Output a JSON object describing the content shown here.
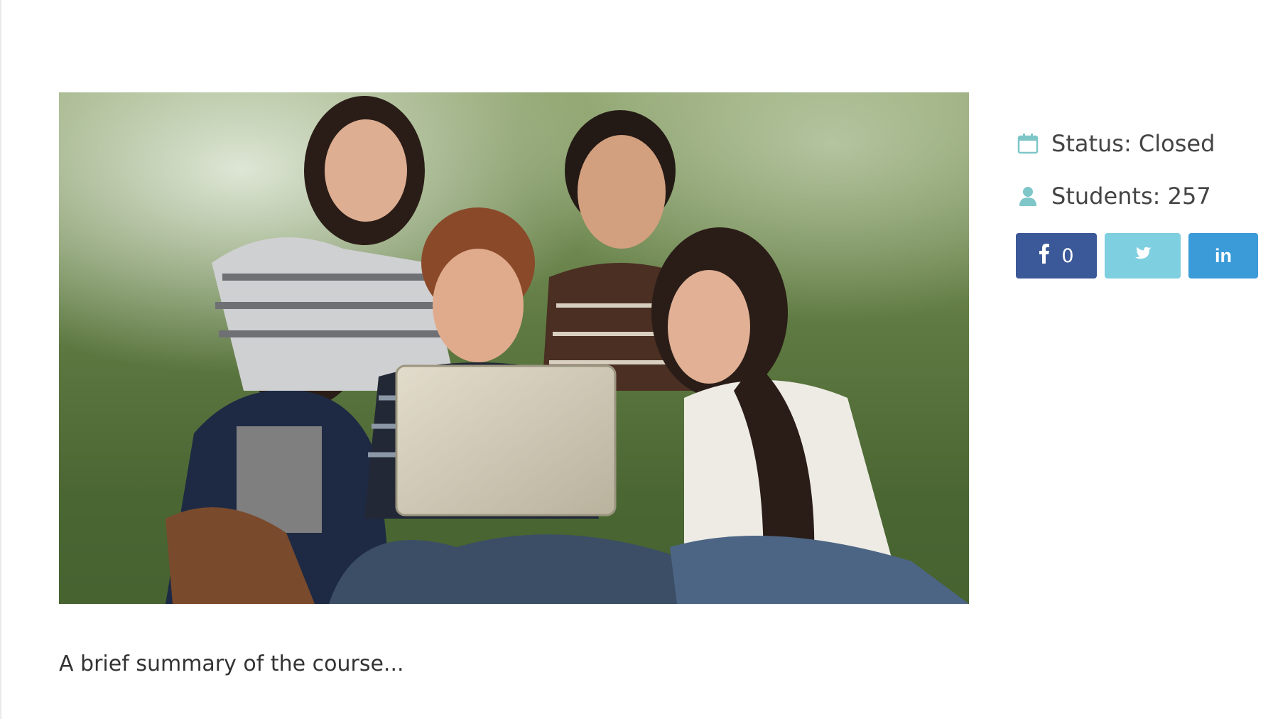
{
  "course": {
    "image_alt": "Group of students laughing around a laptop",
    "summary": "A brief summary of the course..."
  },
  "meta": {
    "status_label": "Status: Closed",
    "status_icon": "calendar-icon",
    "students_label": "Students: 257",
    "students_icon": "user-icon",
    "icon_color": "#7fc6c8"
  },
  "share": {
    "facebook": {
      "icon": "facebook-icon",
      "count": "0",
      "color": "#3b5998"
    },
    "twitter": {
      "icon": "twitter-icon",
      "color": "#7ecfe0"
    },
    "linkedin": {
      "icon": "linkedin-icon",
      "label": "in",
      "color": "#3b9bd9"
    }
  }
}
